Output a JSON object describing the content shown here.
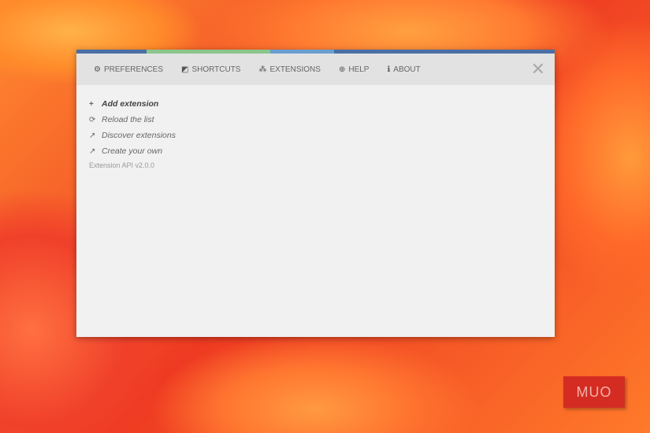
{
  "colors": {
    "bar_blue": "#4a6fa5",
    "bar_green": "#8cc58a",
    "bar_lightblue": "#6a9ed0"
  },
  "tabs": [
    {
      "icon": "⚙",
      "label": "PREFERENCES"
    },
    {
      "icon": "◩",
      "label": "SHORTCUTS"
    },
    {
      "icon": "⁂",
      "label": "EXTENSIONS"
    },
    {
      "icon": "⊕",
      "label": "HELP"
    },
    {
      "icon": "ℹ",
      "label": "ABOUT"
    }
  ],
  "close_icon": "✕",
  "actions": [
    {
      "icon": "+",
      "label": "Add extension"
    },
    {
      "icon": "⟳",
      "label": "Reload the list"
    },
    {
      "icon": "↗",
      "label": "Discover extensions"
    },
    {
      "icon": "↗",
      "label": "Create your own"
    }
  ],
  "version": "Extension API v2.0.0",
  "watermark": "MUO"
}
